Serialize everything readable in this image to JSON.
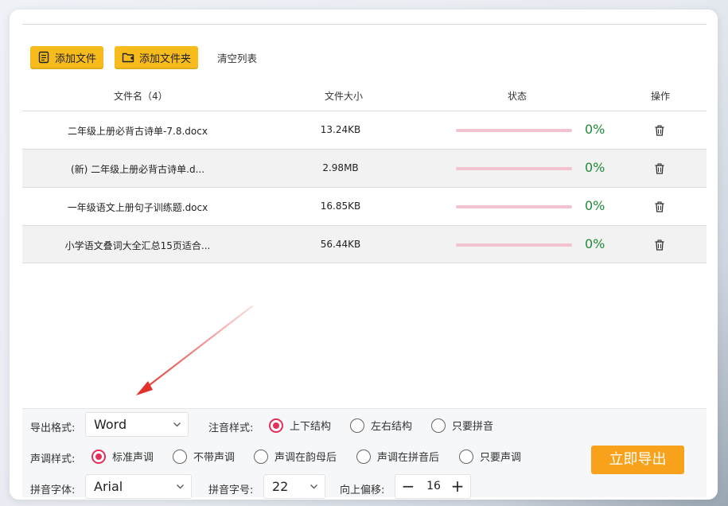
{
  "toolbar": {
    "add_file_label": "添加文件",
    "add_folder_label": "添加文件夹",
    "clear_list_label": "清空列表"
  },
  "table": {
    "headers": {
      "name": "文件名（4）",
      "size": "文件大小",
      "status": "状态",
      "op": "操作"
    },
    "rows": [
      {
        "name": "二年级上册必背古诗单-7.8.docx",
        "size": "13.24KB",
        "progress": 0,
        "percent": "0%"
      },
      {
        "name": "(新) 二年级上册必背古诗单.d...",
        "size": "2.98MB",
        "progress": 0,
        "percent": "0%"
      },
      {
        "name": "一年级语文上册句子训练题.docx",
        "size": "16.85KB",
        "progress": 0,
        "percent": "0%"
      },
      {
        "name": "小学语文叠词大全汇总15页适合...",
        "size": "56.44KB",
        "progress": 0,
        "percent": "0%"
      }
    ]
  },
  "options": {
    "export_format_label": "导出格式:",
    "export_format_value": "Word",
    "annotation_label": "注音样式:",
    "annotation_options": [
      "上下结构",
      "左右结构",
      "只要拼音"
    ],
    "annotation_selected": 0,
    "tone_label": "声调样式:",
    "tone_options": [
      "标准声调",
      "不带声调",
      "声调在韵母后",
      "声调在拼音后",
      "只要声调"
    ],
    "tone_selected": 0,
    "pinyin_font_label": "拼音字体:",
    "pinyin_font_value": "Arial",
    "pinyin_size_label": "拼音字号:",
    "pinyin_size_value": "22",
    "offset_label": "向上偏移:",
    "offset_value": "16",
    "export_button": "立即导出"
  },
  "colors": {
    "toolbar_button": "#f7bc1c",
    "export_button": "#f7a21a",
    "radio_selected": "#e42f5a",
    "progress_track": "#f3c3cf",
    "percent_text": "#1e8a36",
    "annotation_arrow": "#e0322b"
  }
}
